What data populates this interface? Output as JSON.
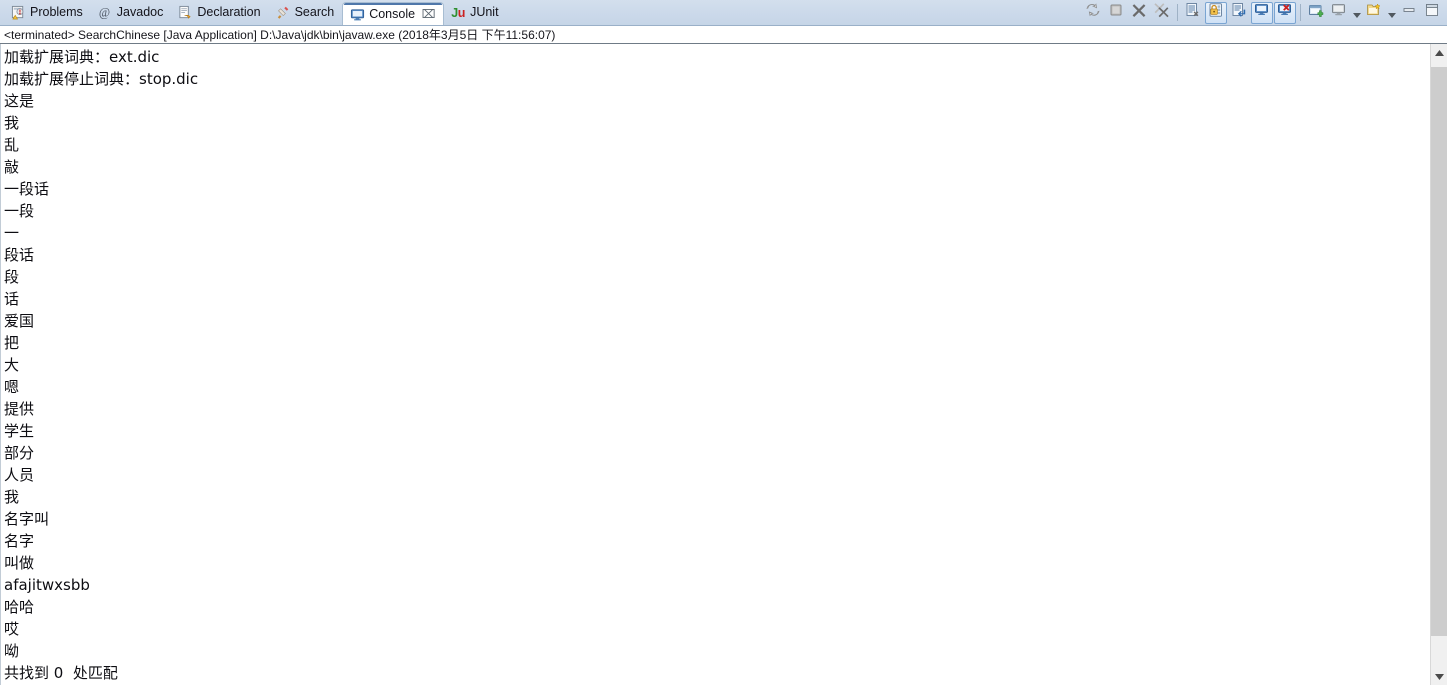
{
  "tabs": [
    {
      "id": "problems",
      "label": "Problems",
      "icon": "problems-icon",
      "active": false,
      "closable": false
    },
    {
      "id": "javadoc",
      "label": "Javadoc",
      "icon": "at-sign-icon",
      "active": false,
      "closable": false
    },
    {
      "id": "declaration",
      "label": "Declaration",
      "icon": "declaration-icon",
      "active": false,
      "closable": false
    },
    {
      "id": "search",
      "label": "Search",
      "icon": "search-icon",
      "active": false,
      "closable": false
    },
    {
      "id": "console",
      "label": "Console",
      "icon": "console-icon",
      "active": true,
      "closable": true
    },
    {
      "id": "junit",
      "label": "JUnit",
      "icon": "junit-icon",
      "active": false,
      "closable": false
    }
  ],
  "tab_close_glyph": "⌧",
  "junit_badge": {
    "j": "J",
    "u": "u"
  },
  "toolbar": {
    "buttons": [
      {
        "id": "relaunch",
        "name": "relaunch-icon",
        "toggled": false
      },
      {
        "id": "terminate",
        "name": "terminate-icon",
        "toggled": false
      },
      {
        "id": "remove-launch",
        "name": "remove-launch-icon",
        "toggled": false
      },
      {
        "id": "remove-all-launches",
        "name": "remove-all-launches-icon",
        "toggled": false
      },
      {
        "id": "clear-console",
        "name": "clear-console-icon",
        "toggled": false
      },
      {
        "id": "scroll-lock",
        "name": "scroll-lock-icon",
        "toggled": true
      },
      {
        "id": "word-wrap",
        "name": "word-wrap-icon",
        "toggled": false
      },
      {
        "id": "show-console-output",
        "name": "show-console-on-output-icon",
        "toggled": true
      },
      {
        "id": "show-console-error",
        "name": "show-console-on-error-icon",
        "toggled": true
      },
      {
        "id": "new-console-view",
        "name": "new-console-view-icon",
        "toggled": false
      },
      {
        "id": "display-console",
        "name": "display-console-icon",
        "toggled": false
      },
      {
        "id": "open-console",
        "name": "open-console-icon",
        "toggled": false
      },
      {
        "id": "minimize",
        "name": "minimize-icon",
        "toggled": false
      },
      {
        "id": "maximize",
        "name": "maximize-icon",
        "toggled": false
      }
    ],
    "dropdown_glyph": "▼"
  },
  "status": {
    "text": "<terminated> SearchChinese [Java Application] D:\\Java\\jdk\\bin\\javaw.exe (2018年3月5日 下午11:56:07)"
  },
  "console": {
    "lines": [
      {
        "text": "加载扩展词典：ext.dic"
      },
      {
        "text": "加载扩展停止词典：stop.dic"
      },
      {
        "text": "这是"
      },
      {
        "text": "我"
      },
      {
        "text": "乱"
      },
      {
        "text": "敲"
      },
      {
        "text": "一段话"
      },
      {
        "text": "一段"
      },
      {
        "text": "一"
      },
      {
        "text": "段话"
      },
      {
        "text": "段"
      },
      {
        "text": "话"
      },
      {
        "text": "爱国"
      },
      {
        "text": "把"
      },
      {
        "text": "大"
      },
      {
        "text": "嗯"
      },
      {
        "text": "提供"
      },
      {
        "text": "学生"
      },
      {
        "text": "部分"
      },
      {
        "text": "人员"
      },
      {
        "text": "我"
      },
      {
        "text": "名字叫"
      },
      {
        "text": "名字"
      },
      {
        "text": "叫做"
      },
      {
        "text": "afajitwxsbb"
      },
      {
        "text": "哈哈"
      },
      {
        "text": "哎"
      },
      {
        "text": "呦"
      },
      {
        "text": "共找到 0  处匹配"
      }
    ]
  },
  "scrollbar": {
    "up_glyph": "▲",
    "down_glyph": "▼"
  },
  "colors": {
    "tabbar_bg": "#cbd9ea",
    "active_tab_bg": "#ffffff",
    "active_tab_accent": "#4f77aa",
    "console_bg": "#ffffff",
    "text": "#0d0d12",
    "toggle_border": "#7aa5d2"
  }
}
